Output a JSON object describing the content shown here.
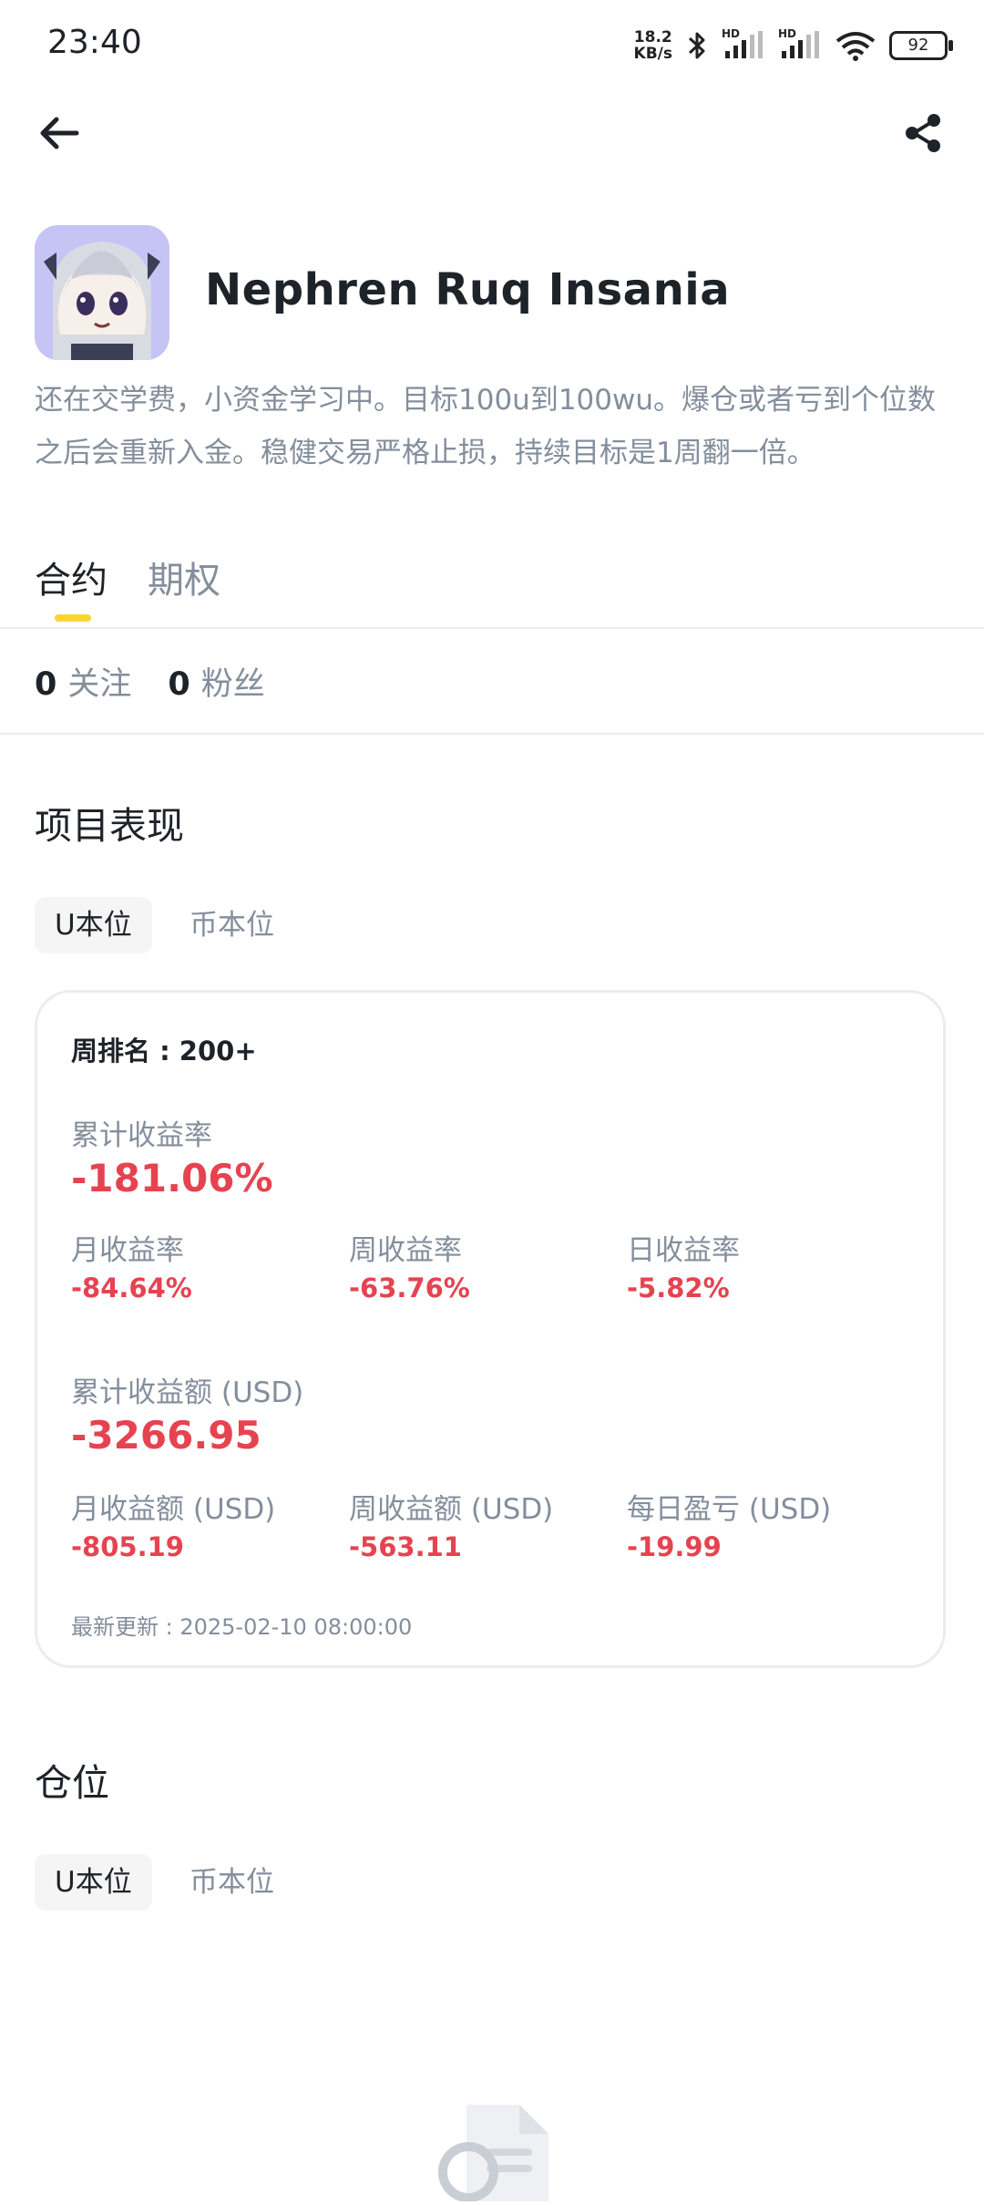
{
  "status_bar": {
    "time": "23:40",
    "net_speed_value": "18.2",
    "net_speed_unit": "KB/s",
    "signal1_label": "HD",
    "signal2_label": "HD",
    "battery": "92"
  },
  "profile": {
    "name": "Nephren Ruq Insania",
    "bio": "还在交学费，小资金学习中。目标100u到100wu。爆仓或者亏到个位数之后会重新入金。稳健交易严格止损，持续目标是1周翻一倍。"
  },
  "tabs": [
    "合约",
    "期权"
  ],
  "follow": {
    "following_count": "0",
    "following_label": "关注",
    "followers_count": "0",
    "followers_label": "粉丝"
  },
  "performance": {
    "title": "项目表现",
    "segments": [
      "U本位",
      "币本位"
    ],
    "rank": "周排名 : 200+",
    "cumulative_rate_label": "累计收益率",
    "cumulative_rate_value": "-181.06%",
    "rates": [
      {
        "label": "月收益率",
        "value": "-84.64%"
      },
      {
        "label": "周收益率",
        "value": "-63.76%"
      },
      {
        "label": "日收益率",
        "value": "-5.82%"
      }
    ],
    "cumulative_amount_label": "累计收益额 (USD)",
    "cumulative_amount_value": "-3266.95",
    "amounts": [
      {
        "label": "月收益额 (USD)",
        "value": "-805.19"
      },
      {
        "label": "周收益额 (USD)",
        "value": "-563.11"
      },
      {
        "label": "每日盈亏 (USD)",
        "value": "-19.99"
      }
    ],
    "updated": "最新更新 : 2025-02-10 08:00:00"
  },
  "positions": {
    "title": "仓位",
    "segments": [
      "U本位",
      "币本位"
    ]
  },
  "colors": {
    "accent_yellow": "#fcd535",
    "loss_red": "#e64350",
    "muted_text": "#848e9c"
  }
}
